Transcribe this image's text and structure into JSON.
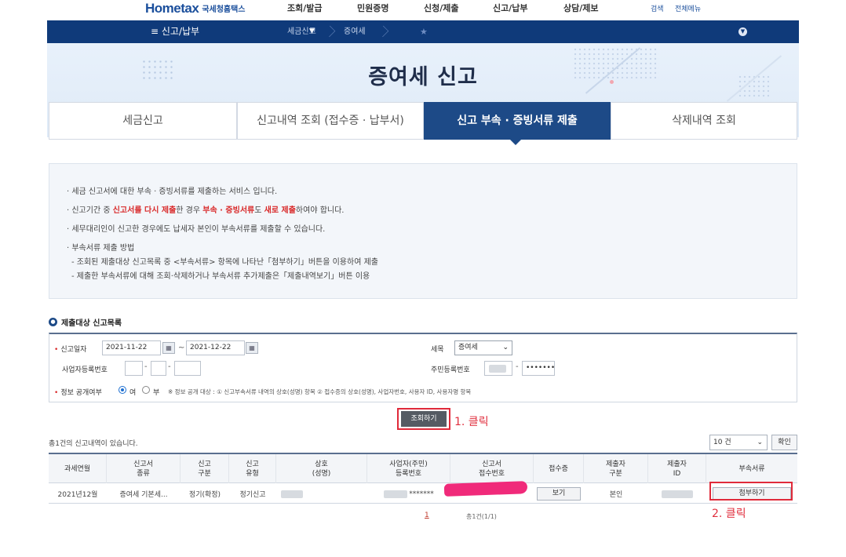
{
  "header": {
    "logo_main": "Hometax",
    "logo_sub": "국세청홈택스",
    "menu": [
      "조회/발급",
      "민원증명",
      "신청/제출",
      "신고/납부",
      "상담/제보"
    ],
    "search_label": "검색",
    "all_menu_label": "전체메뉴"
  },
  "navbar": {
    "menu_label": "신고/납부",
    "breadcrumb": [
      "세금신고",
      "증여세"
    ]
  },
  "banner": {
    "title": "증여세 신고"
  },
  "tabs": [
    {
      "label": "세금신고"
    },
    {
      "label": "신고내역 조회 (접수증 · 납부서)"
    },
    {
      "label": "신고 부속 · 증빙서류 제출"
    },
    {
      "label": "삭제내역 조회"
    }
  ],
  "info": {
    "line1": "· 세금 신고서에 대한 부속 · 증빙서류를 제출하는 서비스 입니다.",
    "line2_a": "· 신고기간 중 ",
    "line2_b": "신고서를 다시 제출",
    "line2_c": "한 경우 ",
    "line2_d": "부속 · 증빙서류",
    "line2_e": "도 ",
    "line2_f": "새로 제출",
    "line2_g": "하여야 합니다.",
    "line3": "· 세무대리인이 신고한 경우에도 납세자 본인이 부속서류를 제출할 수 있습니다.",
    "line4": "· 부속서류 제출 방법",
    "line5": "- 조회된 제출대상 신고목록 중 <부속서류> 항목에 나타난「첨부하기」버튼을 이용하여 제출",
    "line6": "- 제출한 부속서류에 대해 조회·삭제하거나 부속서류 추가제출은「제출내역보기」버튼 이용"
  },
  "section": {
    "title": "제출대상 신고목록"
  },
  "search": {
    "date_label": "신고일자",
    "date_from": "2021-11-22",
    "date_to": "2021-12-22",
    "tilde": "~",
    "tax_label": "세목",
    "tax_value": "증여세",
    "bizno_label": "사업자등록번호",
    "resno_label": "주민등록번호",
    "resno_masked": "•••••••",
    "disclose_label": "정보 공개여부",
    "yes_label": "여",
    "no_label": "부",
    "disclose_note": "※ 정보 공개 대상 : ① 신고부속서류 내역의 상호(성명) 항목 ② 접수증의 상호(성명), 사업자번호, 사용자 ID, 사용자명 항목",
    "search_button": "조회하기",
    "annotation1": "1. 클릭"
  },
  "list": {
    "count_text": "총1건의 신고내역이 있습니다.",
    "page_size": "10 건",
    "confirm_button": "확인",
    "columns": [
      "과세연월",
      "신고서\n종류",
      "신고\n구분",
      "신고\n유형",
      "상호\n(성명)",
      "사업자(주민)\n등록번호",
      "신고서\n접수번호",
      "접수증",
      "제출자\n구분",
      "제출자\nID",
      "부속서류"
    ],
    "row": {
      "period": "2021년12월",
      "form_type": "증여세 기본세...",
      "report_kind": "정기(확정)",
      "report_type": "정기신고",
      "regno_masked": "*******",
      "view_button": "보기",
      "submitter_kind": "본인",
      "attach_button": "첨부하기"
    },
    "annotation2": "2. 클릭",
    "pager_current": "1",
    "pager_total": "총1건(1/1)"
  }
}
